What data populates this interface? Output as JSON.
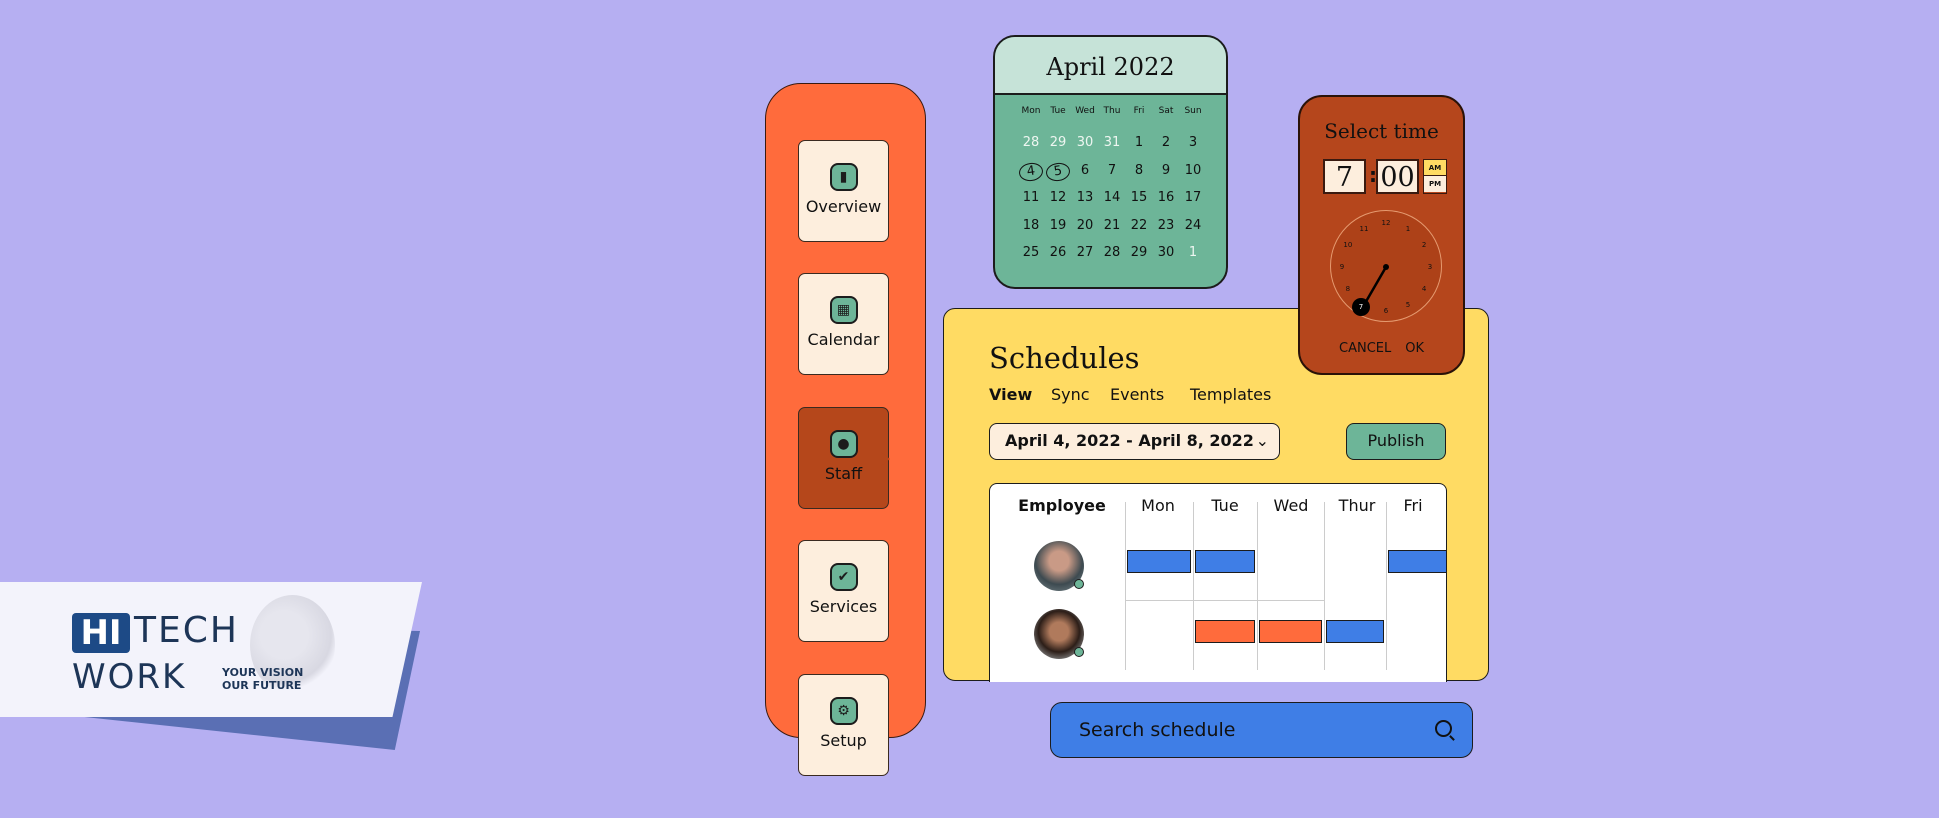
{
  "logo": {
    "hi": "HI",
    "tech": "TECH",
    "work": "WORK",
    "tagline1": "YOUR VISION",
    "tagline2": "OUR FUTURE"
  },
  "colors": {
    "background": "#b6aff2",
    "sidebar": "#ff6b3c",
    "active": "#b5471b",
    "green": "#6db598",
    "yellow": "#ffdb63",
    "blue": "#3f7ee6",
    "cream": "#fdeedd"
  },
  "sidebar": {
    "items": [
      {
        "label": "Overview",
        "icon": "bar-chart-icon",
        "active": false
      },
      {
        "label": "Calendar",
        "icon": "calendar-icon",
        "active": false
      },
      {
        "label": "Staff",
        "icon": "person-icon",
        "active": true
      },
      {
        "label": "Services",
        "icon": "shield-check-icon",
        "active": false
      },
      {
        "label": "Setup",
        "icon": "gear-icon",
        "active": false
      }
    ]
  },
  "calendar": {
    "title": "April 2022",
    "weekdays": [
      "Mon",
      "Tue",
      "Wed",
      "Thu",
      "Fri",
      "Sat",
      "Sun"
    ],
    "weeks": [
      [
        "28",
        "29",
        "30",
        "31",
        "1",
        "2",
        "3"
      ],
      [
        "4",
        "5",
        "6",
        "7",
        "8",
        "9",
        "10"
      ],
      [
        "11",
        "12",
        "13",
        "14",
        "15",
        "16",
        "17"
      ],
      [
        "18",
        "19",
        "20",
        "21",
        "22",
        "23",
        "24"
      ],
      [
        "25",
        "26",
        "27",
        "28",
        "29",
        "30",
        "1"
      ]
    ],
    "selected": [
      "4",
      "5"
    ]
  },
  "time_picker": {
    "title": "Select time",
    "hour": "7",
    "separator": ":",
    "minute": "00",
    "am": "AM",
    "pm": "PM",
    "selected_period": "AM",
    "dial": [
      "12",
      "1",
      "2",
      "3",
      "4",
      "5",
      "6",
      "7",
      "8",
      "9",
      "10",
      "11"
    ],
    "cancel": "CANCEL",
    "ok": "OK"
  },
  "schedules": {
    "title": "Schedules",
    "tabs": [
      "View",
      "Sync",
      "Events",
      "Templates"
    ],
    "active_tab": "View",
    "date_range": "April 4, 2022 - April 8, 2022",
    "publish": "Publish",
    "columns": [
      "Employee",
      "Mon",
      "Tue",
      "Wed",
      "Thur",
      "Fri"
    ],
    "rows": [
      {
        "shifts": [
          "blue",
          "blue",
          "",
          "",
          "blue"
        ]
      },
      {
        "shifts": [
          "",
          "orange",
          "orange",
          "blue",
          ""
        ]
      }
    ]
  },
  "search": {
    "placeholder": "Search schedule"
  }
}
